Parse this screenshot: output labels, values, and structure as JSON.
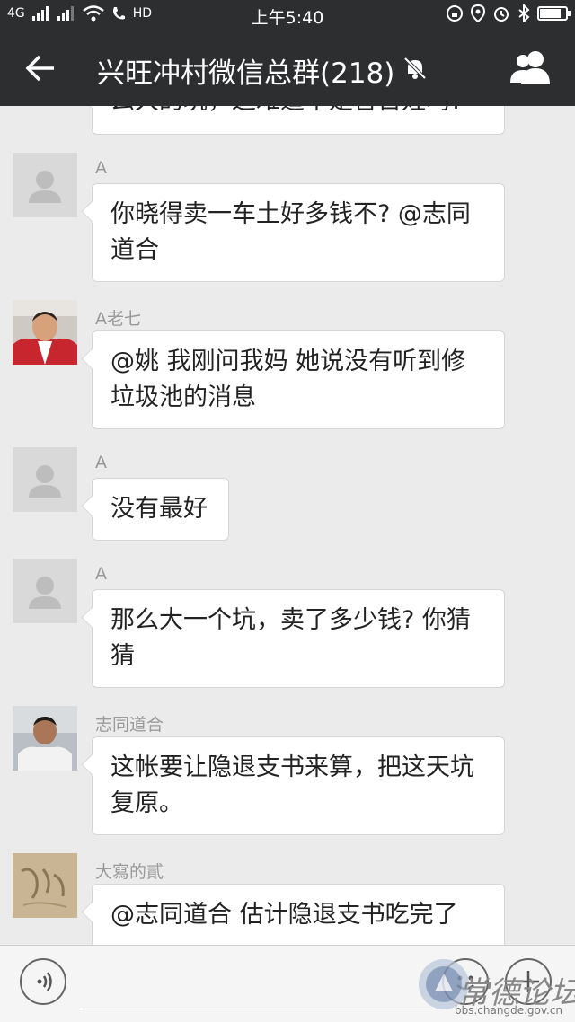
{
  "status_bar": {
    "signal_text": "4G",
    "hd_label": "HD",
    "time": "上午5:40",
    "battery_level": 0.9
  },
  "header": {
    "title": "兴旺冲村微信总群(218)",
    "back_icon": "arrow-left-icon",
    "mute_icon": "bell-off-icon",
    "members_icon": "people-icon"
  },
  "messages": [
    {
      "sender": "",
      "lines": [
        "么大的坑，这难道不是害百姓吗?"
      ],
      "avatar": "none"
    },
    {
      "sender": "A",
      "lines": [
        "你晓得卖一车土好多钱不? @志同",
        "道合"
      ],
      "avatar": "default"
    },
    {
      "sender": "A老七",
      "lines": [
        "@姚  我刚问我妈  她说没有听到修",
        "垃圾池的消息"
      ],
      "avatar": "photo-red"
    },
    {
      "sender": "A",
      "lines": [
        "没有最好"
      ],
      "avatar": "default"
    },
    {
      "sender": "A",
      "lines": [
        "那么大一个坑，卖了多少钱? 你猜",
        "猜"
      ],
      "avatar": "default"
    },
    {
      "sender": "志同道合",
      "lines": [
        "这帐要让隐退支书来算，把这天坑",
        "复原。"
      ],
      "avatar": "photo-man"
    },
    {
      "sender": "大寫的貳",
      "lines": [
        "@志同道合  估计隐退支书吃完了"
      ],
      "avatar": "photo-sand"
    }
  ],
  "input_bar": {
    "voice_icon": "voice-icon",
    "emoji_icon": "emoji-icon",
    "plus_icon": "plus-icon"
  },
  "watermark": {
    "text": "常德论坛",
    "url": "bbs.changde.gov.cn"
  }
}
